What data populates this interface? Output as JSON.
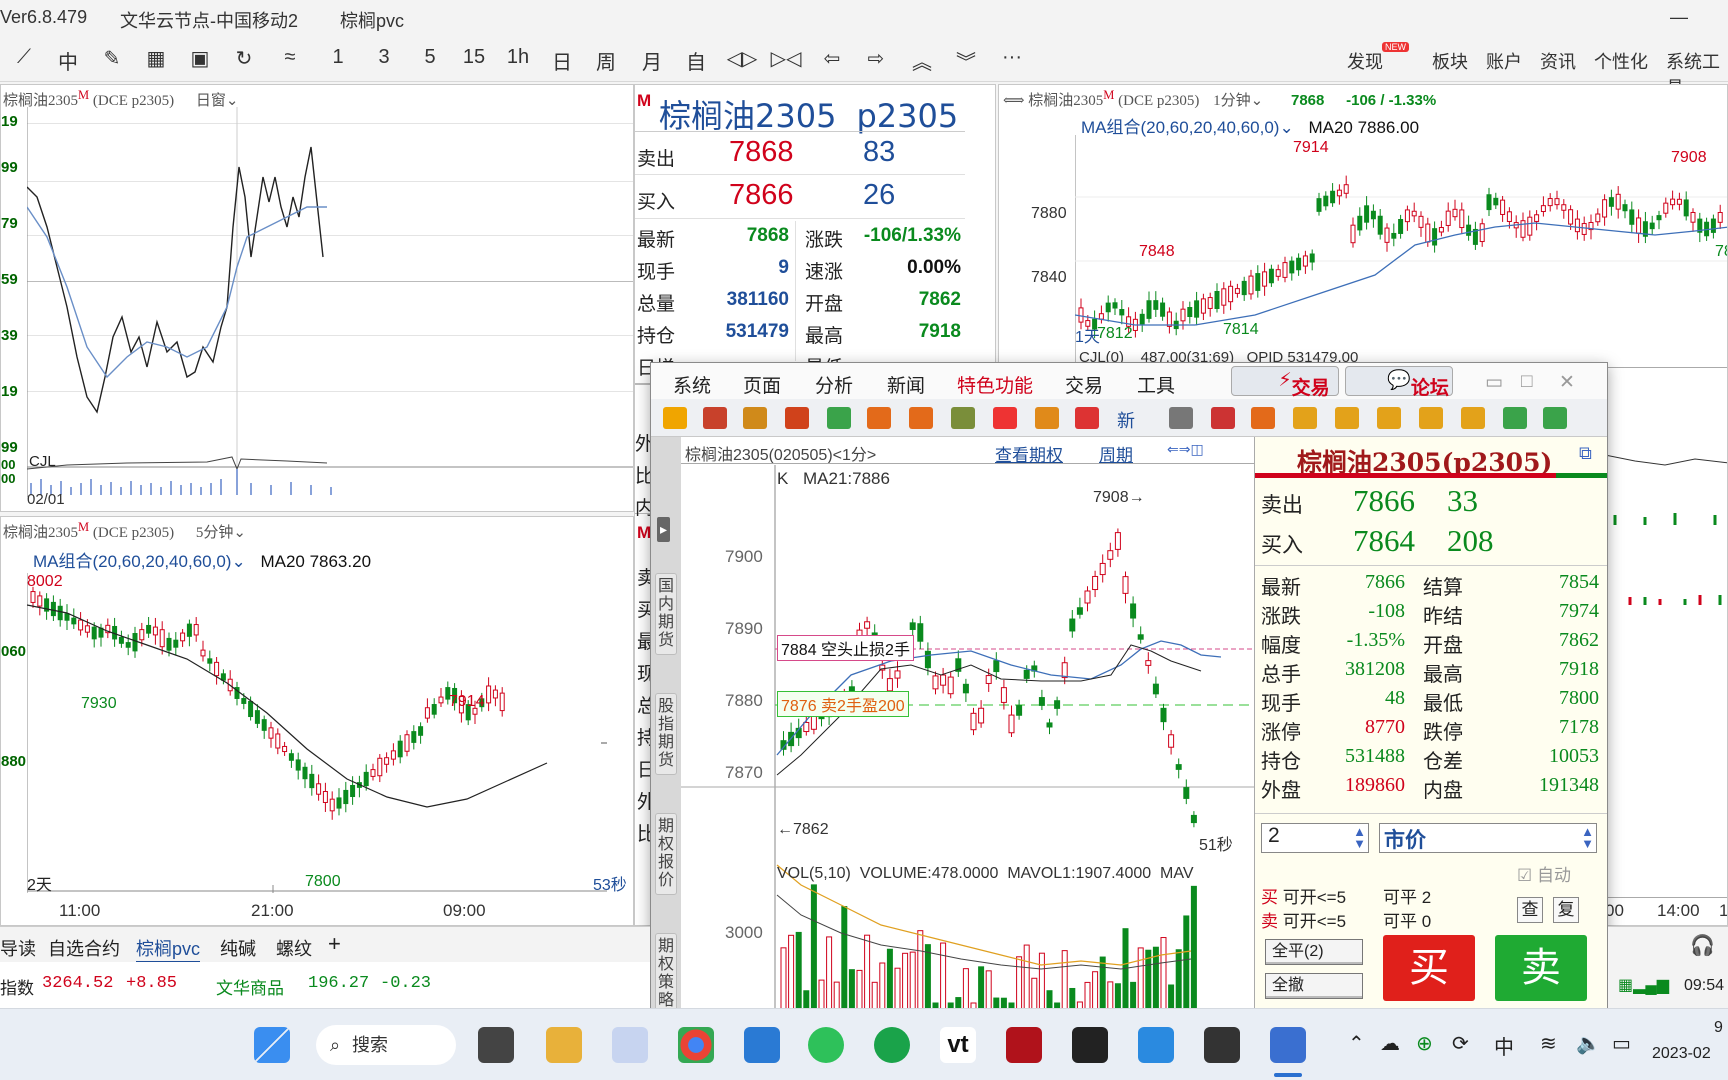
{
  "titlebar": {
    "version": "Ver6.8.479",
    "server": "文华云节点-中国移动2",
    "contract": "棕榈pvc",
    "minimize": "—"
  },
  "toolbar": {
    "periods": [
      "1",
      "3",
      "5",
      "15",
      "1h",
      "日",
      "周",
      "月",
      "自"
    ],
    "right_menu": [
      "发现",
      "板块",
      "账户",
      "资讯",
      "个性化",
      "系统工具"
    ],
    "new_badge": "NEW",
    "more": "···"
  },
  "chart_daily": {
    "header": "棕榈油2305",
    "header_sup": "M",
    "header_code": "(DCE p2305)",
    "header_mode": "日窗",
    "yticks": [
      "19",
      "99",
      "79",
      "59",
      "39",
      "19",
      "99"
    ],
    "indicator": "CJL",
    "indicator_ticks": [
      "00",
      "00"
    ],
    "date_label": "02/01"
  },
  "chart_5min": {
    "header": "棕榈油2305",
    "header_sup": "M",
    "header_code": "(DCE p2305)",
    "header_period": "5分钟",
    "ma_label": "MA组合(20,60,20,40,60,0)",
    "ma20": "MA20 7863.20",
    "yticks": [
      "060",
      "880"
    ],
    "marks": {
      "high": "8002",
      "low1": "7930",
      "peak": "7914",
      "low": "7800"
    },
    "days": "2天",
    "countdown": "53秒",
    "xticks": [
      "11:00",
      "21:00",
      "09:00"
    ]
  },
  "quote_mid": {
    "flag": "M",
    "title": "棕榈油2305",
    "code": "p2305",
    "sell_label": "卖出",
    "sell_price": "7868",
    "sell_vol": "83",
    "buy_label": "买入",
    "buy_price": "7866",
    "buy_vol": "26",
    "rows": [
      {
        "l1": "最新",
        "v1": "7868",
        "l2": "涨跌",
        "v2": "-106/1.33%"
      },
      {
        "l1": "现手",
        "v1": "9",
        "l2": "速涨",
        "v2": "0.00%"
      },
      {
        "l1": "总量",
        "v1": "381160",
        "l2": "开盘",
        "v2": "7862"
      },
      {
        "l1": "持仓",
        "v1": "531479",
        "l2": "最高",
        "v2": "7918"
      }
    ],
    "partial_labels": [
      "日增",
      "最低"
    ],
    "lower_flag": "M",
    "lower_labels": [
      "卖",
      "买",
      "最",
      "现",
      "总",
      "持",
      "日",
      "外",
      "比"
    ]
  },
  "chart_1min": {
    "header": "棕榈油2305",
    "header_sup": "M",
    "header_code": "(DCE p2305)",
    "header_period": "1分钟",
    "last": "7868",
    "change": "-106 / -1.33%",
    "ma_label": "MA组合(20,60,20,40,60,0)",
    "ma20": "MA20 7886.00",
    "yticks": [
      "7880",
      "7840"
    ],
    "marks": {
      "hi1": "7914",
      "hi2": "7908",
      "m1": "7848",
      "lo1": "7812",
      "lo2": "7814",
      "edge": "78"
    },
    "days": "1天",
    "cjl_line": "CJL(0)    487.00(31:69)   OPID 531479.00",
    "xticks": [
      "00",
      "14:00",
      "1"
    ]
  },
  "trade_window": {
    "menu": [
      "系统",
      "页面",
      "分析",
      "新闻",
      "特色功能",
      "交易",
      "工具"
    ],
    "btn_trade": "交易",
    "btn_forum": "论坛",
    "icon_new": "新",
    "chart_header": "棕榈油2305(020505)<1分>",
    "link_rights": "查看期权",
    "link_period": "周期",
    "k_label": "K",
    "ma21": "MA21:7886",
    "yticks": [
      "7900",
      "7890",
      "7880",
      "7870"
    ],
    "vol_ytick": "3000",
    "hi_mark": "7908",
    "lo_mark": "7862",
    "stop_line": "7884 空头止损2手",
    "profit_line": "7876 卖2手盈200",
    "countdown": "51秒",
    "vol_label": "VOL(5,10)  VOLUME:478.0000  MAVOL1:1907.4000  MAV",
    "side_tabs": [
      "国内期货",
      "股指期货",
      "期权报价",
      "期权策略"
    ],
    "quote": {
      "title": "棕榈油2305(p2305)",
      "sell_label": "卖出",
      "sell_price": "7866",
      "sell_vol": "33",
      "buy_label": "买入",
      "buy_price": "7864",
      "buy_vol": "208",
      "rows": [
        {
          "l1": "最新",
          "v1": "7866",
          "l2": "结算",
          "v2": "7854"
        },
        {
          "l1": "涨跌",
          "v1": "-108",
          "l2": "昨结",
          "v2": "7974"
        },
        {
          "l1": "幅度",
          "v1": "-1.35%",
          "l2": "开盘",
          "v2": "7862"
        },
        {
          "l1": "总手",
          "v1": "381208",
          "l2": "最高",
          "v2": "7918"
        },
        {
          "l1": "现手",
          "v1": "48",
          "l2": "最低",
          "v2": "7800"
        },
        {
          "l1": "涨停",
          "v1": "8770",
          "l2": "跌停",
          "v2": "7178"
        },
        {
          "l1": "持仓",
          "v1": "531488",
          "l2": "仓差",
          "v2": "10053"
        },
        {
          "l1": "外盘",
          "v1": "189860",
          "l2": "内盘",
          "v2": "191348"
        }
      ]
    },
    "order": {
      "qty": "2",
      "price_type": "市价",
      "auto": "自动",
      "buy_hint_a": "买",
      "buy_hint_b": "可开<=5",
      "sell_hint_a": "卖",
      "sell_hint_b": "可开<=5",
      "close_buy": "可平 2",
      "close_sell": "可平 0",
      "btn_query": "查",
      "btn_reset": "复",
      "btn_close_all": "全平(2)",
      "btn_cancel_all": "全撤",
      "btn_buy": "买",
      "btn_sell": "卖"
    }
  },
  "bottom_tabs": [
    "导读",
    "自选合约",
    "棕榈pvc",
    "纯碱",
    "螺纹"
  ],
  "active_tab": "棕榈pvc",
  "add_tab": "+",
  "index_bar": {
    "i1_name": "指数",
    "i1_val": "3264.52",
    "i1_chg": "+8.85",
    "i2_name": "文华商品",
    "i2_val": "196.27",
    "i2_chg": "-0.23"
  },
  "status_time": "09:54",
  "taskbar": {
    "search": "搜索",
    "ime": "中",
    "clock_top": "9",
    "clock_date": "2023-02"
  }
}
